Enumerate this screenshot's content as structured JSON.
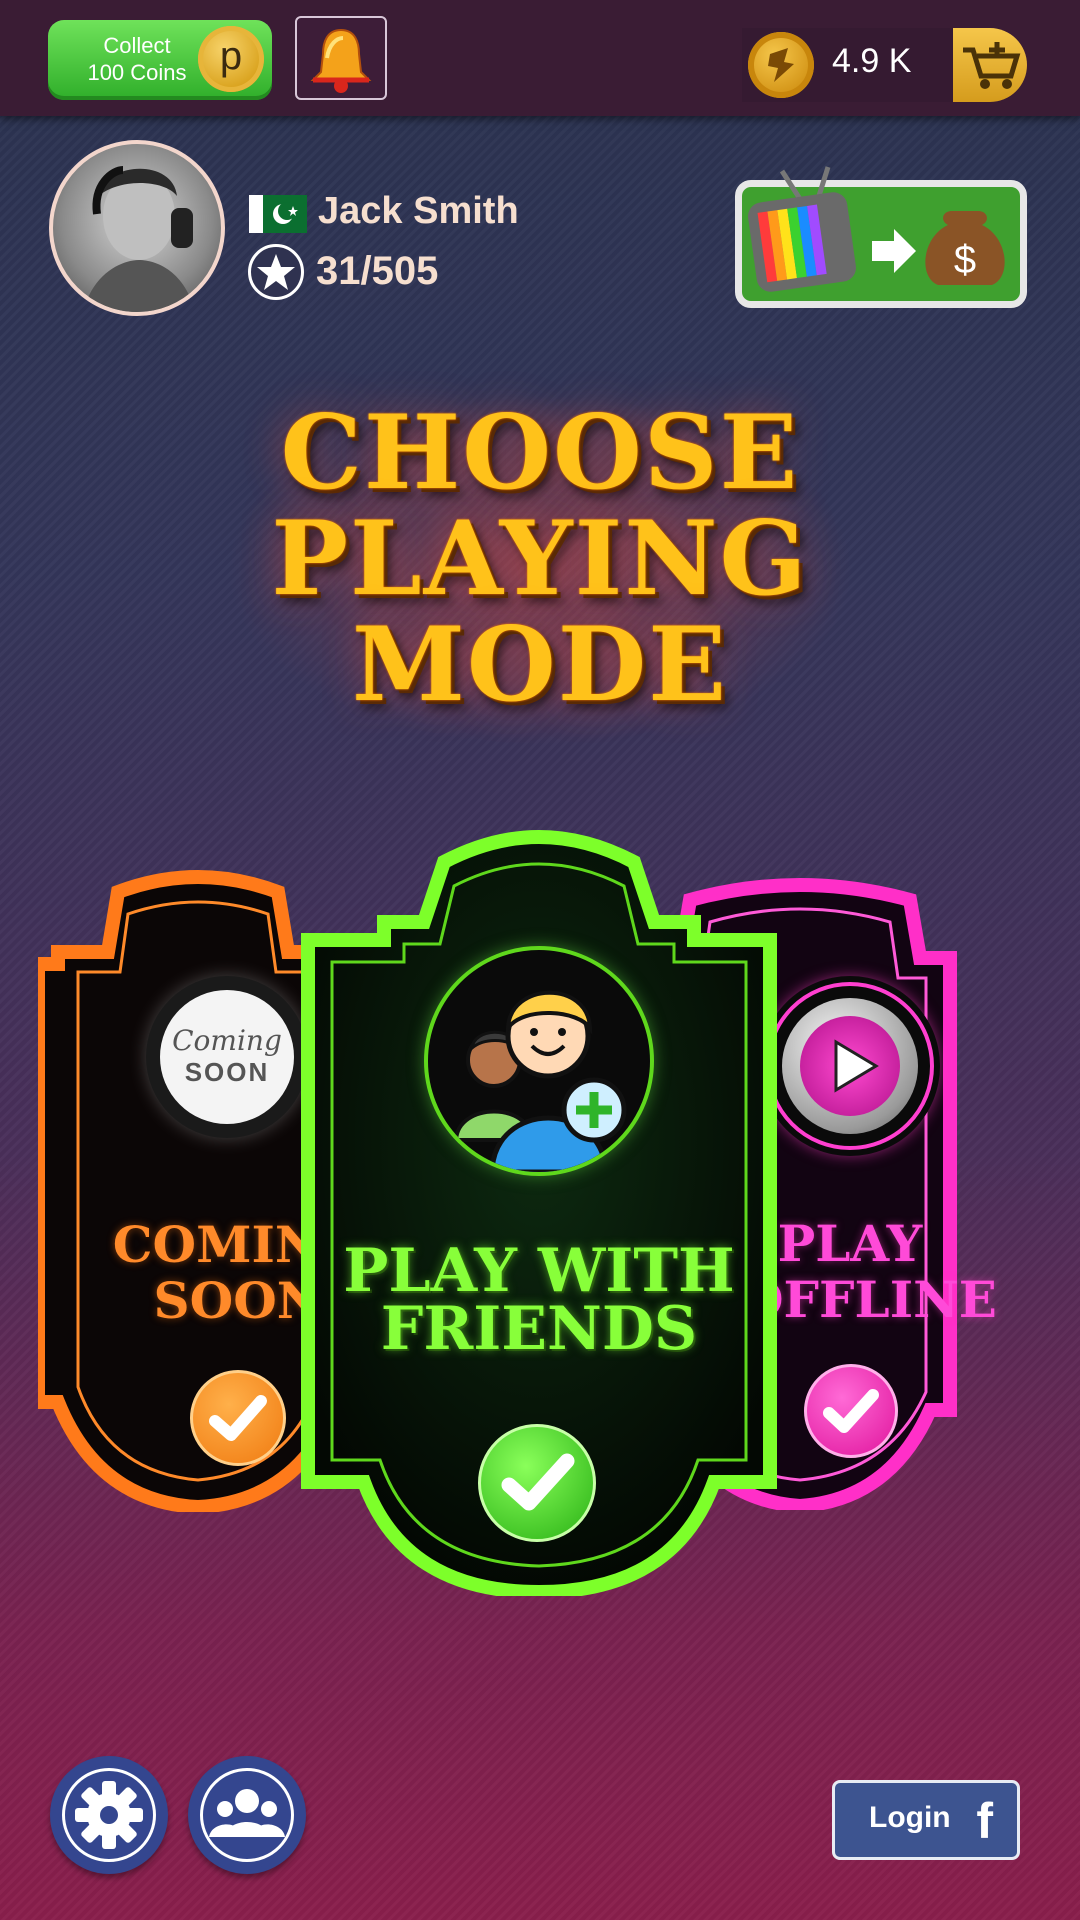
{
  "topbar": {
    "collect_label": "Collect\n100 Coins",
    "collect_coin_letter": "p",
    "bell_icon": "bell-icon",
    "coin_balance": "4.9 K",
    "cart_icon": "cart-add-icon"
  },
  "profile": {
    "name": "Jack Smith",
    "country_flag": "pakistan-flag-icon",
    "level": "31/505",
    "level_icon": "star-badge-icon"
  },
  "reward_button": {
    "icon": "tv-to-money-icon"
  },
  "title": {
    "line1": "CHOOSE",
    "line2": "PLAYING",
    "line3": "MODE"
  },
  "modes": [
    {
      "label_line1": "COMING",
      "label_line2": "SOON",
      "icon_text_1": "Coming",
      "icon_text_2": "SOON",
      "color": "#ff7a1a"
    },
    {
      "label_line1": "PLAY WITH",
      "label_line2": "FRIENDS",
      "icon": "friends-add-icon",
      "color": "#7dff2a"
    },
    {
      "label_line1": "PLAY",
      "label_line2": "OFFLINE",
      "icon": "play-icon",
      "color": "#ff2fc8"
    }
  ],
  "footer": {
    "settings_icon": "gear-icon",
    "friends_icon": "group-icon",
    "login_label": "Login",
    "facebook_icon": "f"
  }
}
